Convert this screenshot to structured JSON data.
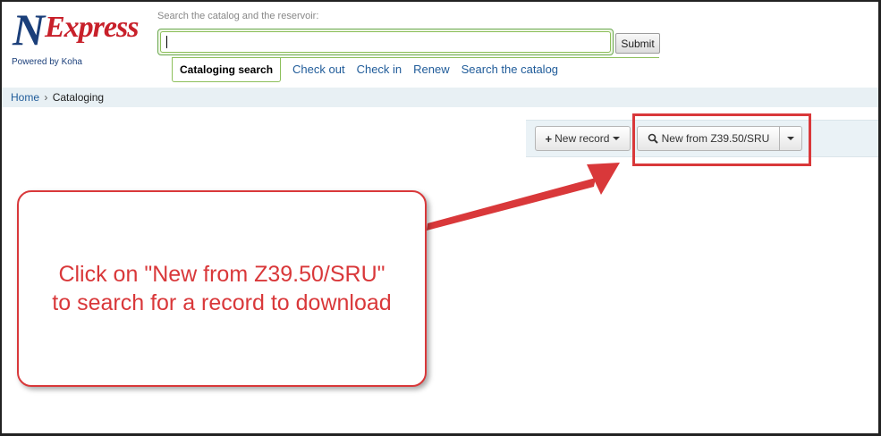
{
  "header": {
    "logo": {
      "letter": "N",
      "word": "Express"
    },
    "powered_by": "Powered by Koha",
    "search_label": "Search the catalog and the reservoir:",
    "search_value": "",
    "submit_label": "Submit",
    "tabs": [
      {
        "label": "Cataloging search",
        "active": true
      },
      {
        "label": "Check out"
      },
      {
        "label": "Check in"
      },
      {
        "label": "Renew"
      },
      {
        "label": "Search the catalog"
      }
    ]
  },
  "breadcrumb": {
    "home": "Home",
    "separator": "›",
    "current": "Cataloging"
  },
  "toolbar": {
    "new_record_label": "New record",
    "z3950_label": "New from Z39.50/SRU"
  },
  "callout": {
    "line1": "Click on \"New from Z39.50/SRU\"",
    "line2": "to search for a record to download"
  },
  "colors": {
    "brand_blue": "#1b3f7a",
    "brand_red": "#c8202a",
    "link": "#1f5b99",
    "annotation": "#d9383a",
    "search_accent": "#8cbf5a"
  }
}
